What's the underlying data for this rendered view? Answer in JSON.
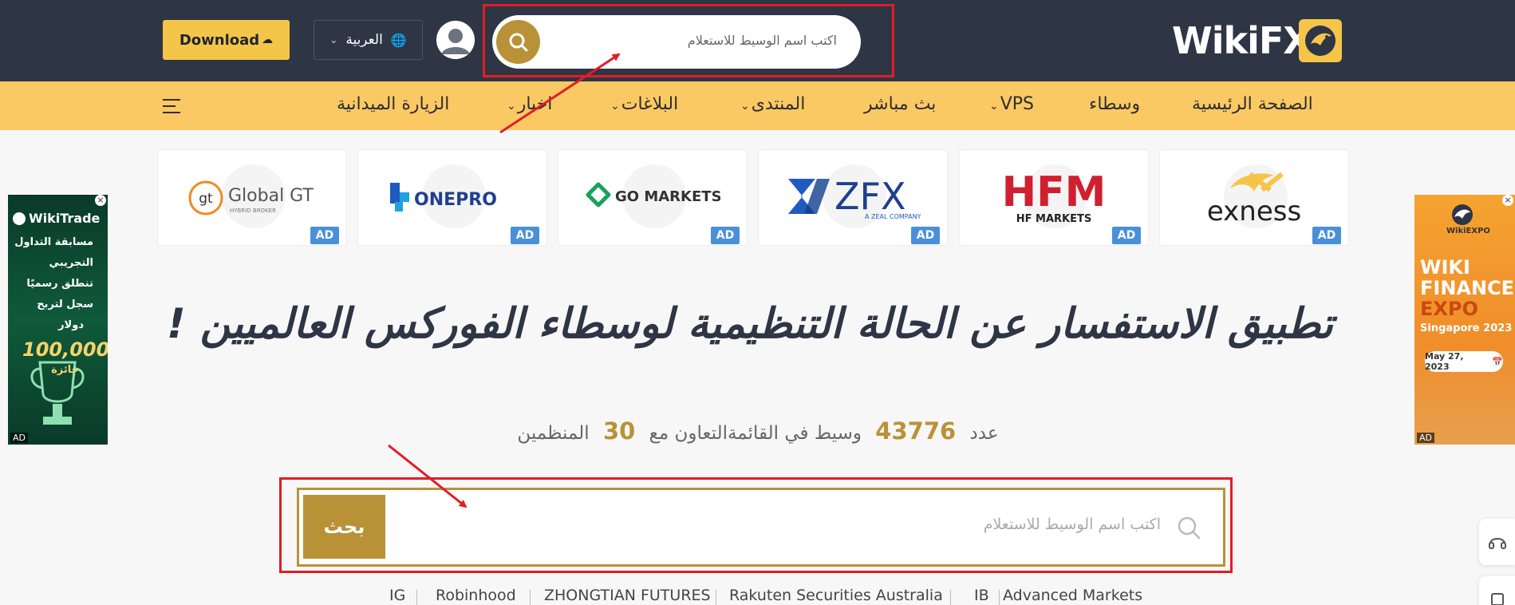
{
  "header": {
    "download_label": "Download",
    "language_label": "العربية",
    "search_placeholder": "اكتب اسم الوسيط للاستعلام",
    "logo_text": "WikiFX"
  },
  "nav": {
    "items": [
      {
        "label": "الصفحة الرئيسية"
      },
      {
        "label": "وسطاء"
      },
      {
        "label": "VPS"
      },
      {
        "label": "بث مباشر"
      },
      {
        "label": "المنتدى"
      },
      {
        "label": "البلاغات"
      },
      {
        "label": "اخبار"
      },
      {
        "label": "الزيارة الميدانية"
      }
    ]
  },
  "brokers": [
    {
      "name": "Global GT",
      "tagline": "HYBRID BROKER",
      "mark": "gt",
      "ad": "AD"
    },
    {
      "name": "ONEPRO",
      "ad": "AD"
    },
    {
      "name": "GO MARKETS",
      "ad": "AD"
    },
    {
      "name": "ZFX",
      "tagline": "A ZEAL COMPANY",
      "ad": "AD"
    },
    {
      "name": "HFM",
      "tagline": "HF MARKETS",
      "ad": "AD"
    },
    {
      "name": "exness",
      "ad": "AD"
    }
  ],
  "left_ad": {
    "title": "WikiTrade",
    "lines": [
      "مسابقة التداول",
      "التجريبي",
      "تنطلق رسميًا",
      "سجل لتربح",
      "دولار"
    ],
    "amount": "100,000",
    "amount_suffix": "جائزة",
    "tag": "AD",
    "close": "×"
  },
  "right_ad": {
    "brand": "WikiEXPO",
    "line1": "WIKI",
    "line2": "FINANCE",
    "line3": "EXPO",
    "location": "Singapore 2023",
    "date": "May 27, 2023",
    "tag": "AD",
    "close": "×"
  },
  "hero": {
    "title": "تطبيق الاستفسار عن الحالة التنظيمية لوسطاء الفوركس العالميين !",
    "count_prefix": "عدد",
    "broker_count": "43776",
    "count_mid": "وسيط في القائمةالتعاون مع",
    "regulator_count": "30",
    "count_suffix": "المنظمين"
  },
  "main_search": {
    "button_label": "بحث",
    "placeholder": "اكتب اسم الوسيط للاستعلام"
  },
  "popular": [
    "IG",
    "Robinhood",
    "ZHONGTIAN FUTURES",
    "Rakuten Securities Australia",
    "IB",
    "Advanced Markets"
  ],
  "colors": {
    "header_bg": "#2e3545",
    "nav_bg": "#fbc964",
    "gold": "#b99238",
    "download_bg": "#f5c54a",
    "annotation_red": "#e21d26"
  }
}
